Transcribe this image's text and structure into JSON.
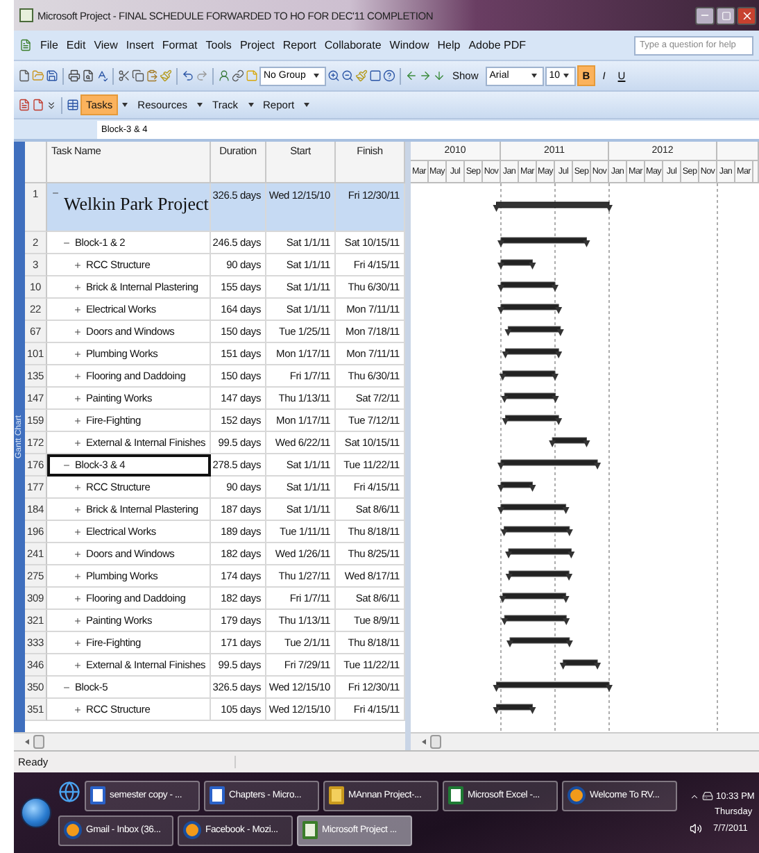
{
  "window": {
    "title": "Microsoft Project - FINAL SCHEDULE FORWARDED TO HO FOR DEC'11 COMPLETION"
  },
  "menu": [
    "File",
    "Edit",
    "View",
    "Insert",
    "Format",
    "Tools",
    "Project",
    "Report",
    "Collaborate",
    "Window",
    "Help",
    "Adobe PDF"
  ],
  "help_search": {
    "placeholder": "Type a question for help"
  },
  "toolbar": {
    "group_dropdown": "No Group",
    "show_button": "Show",
    "font_dropdown": "Arial",
    "size_dropdown": "10",
    "format_buttons": [
      {
        "label": "B",
        "selected": true
      },
      {
        "label": "I",
        "selected": false
      },
      {
        "label": "U",
        "selected": false
      }
    ]
  },
  "guide_toolbar": [
    {
      "label": "Tasks",
      "selected": true
    },
    {
      "label": "Resources",
      "selected": false
    },
    {
      "label": "Track",
      "selected": false
    },
    {
      "label": "Report",
      "selected": false
    }
  ],
  "entry_bar": {
    "value": "Block-3 & 4"
  },
  "view_bar": {
    "label": "Gantt Chart"
  },
  "table": {
    "columns": [
      "Task Name",
      "Duration",
      "Start",
      "Finish"
    ],
    "tasks": [
      {
        "id": "1",
        "name": "Welkin Park Project",
        "duration": "326.5 days",
        "start": "Wed 12/15/10",
        "finish": "Fri 12/30/11",
        "kind": "project",
        "expanded": true,
        "selected": false,
        "children": [
          {
            "id": "2",
            "name": "Block-1 & 2",
            "duration": "246.5 days",
            "start": "Sat 1/1/11",
            "finish": "Sat 10/15/11",
            "kind": "summary",
            "expanded": true,
            "selected": false,
            "children": [
              {
                "id": "3",
                "name": "RCC Structure",
                "duration": "90 days",
                "start": "Sat 1/1/11",
                "finish": "Fri 4/15/11",
                "kind": "summary",
                "expanded": false,
                "selected": false
              },
              {
                "id": "10",
                "name": "Brick & Internal Plastering",
                "duration": "155 days",
                "start": "Sat 1/1/11",
                "finish": "Thu 6/30/11",
                "kind": "summary",
                "expanded": false,
                "selected": false
              },
              {
                "id": "22",
                "name": "Electrical Works",
                "duration": "164 days",
                "start": "Sat 1/1/11",
                "finish": "Mon 7/11/11",
                "kind": "summary",
                "expanded": false,
                "selected": false
              },
              {
                "id": "67",
                "name": "Doors and Windows",
                "duration": "150 days",
                "start": "Tue 1/25/11",
                "finish": "Mon 7/18/11",
                "kind": "summary",
                "expanded": false,
                "selected": false
              },
              {
                "id": "101",
                "name": "Plumbing Works",
                "duration": "151 days",
                "start": "Mon 1/17/11",
                "finish": "Mon 7/11/11",
                "kind": "summary",
                "expanded": false,
                "selected": false
              },
              {
                "id": "135",
                "name": "Flooring and Daddoing",
                "duration": "150 days",
                "start": "Fri 1/7/11",
                "finish": "Thu 6/30/11",
                "kind": "summary",
                "expanded": false,
                "selected": false
              },
              {
                "id": "147",
                "name": "Painting Works",
                "duration": "147 days",
                "start": "Thu 1/13/11",
                "finish": "Sat 7/2/11",
                "kind": "summary",
                "expanded": false,
                "selected": false
              },
              {
                "id": "159",
                "name": "Fire-Fighting",
                "duration": "152 days",
                "start": "Mon 1/17/11",
                "finish": "Tue 7/12/11",
                "kind": "summary",
                "expanded": false,
                "selected": false
              },
              {
                "id": "172",
                "name": "External & Internal Finishes",
                "duration": "99.5 days",
                "start": "Wed 6/22/11",
                "finish": "Sat 10/15/11",
                "kind": "summary",
                "expanded": false,
                "selected": false
              }
            ]
          },
          {
            "id": "176",
            "name": "Block-3 & 4",
            "duration": "278.5 days",
            "start": "Sat 1/1/11",
            "finish": "Tue 11/22/11",
            "kind": "summary",
            "expanded": true,
            "selected": true,
            "children": [
              {
                "id": "177",
                "name": "RCC Structure",
                "duration": "90 days",
                "start": "Sat 1/1/11",
                "finish": "Fri 4/15/11",
                "kind": "summary",
                "expanded": false,
                "selected": false
              },
              {
                "id": "184",
                "name": "Brick & Internal Plastering",
                "duration": "187 days",
                "start": "Sat 1/1/11",
                "finish": "Sat 8/6/11",
                "kind": "summary",
                "expanded": false,
                "selected": false
              },
              {
                "id": "196",
                "name": "Electrical Works",
                "duration": "189 days",
                "start": "Tue 1/11/11",
                "finish": "Thu 8/18/11",
                "kind": "summary",
                "expanded": false,
                "selected": false
              },
              {
                "id": "241",
                "name": "Doors and Windows",
                "duration": "182 days",
                "start": "Wed 1/26/11",
                "finish": "Thu 8/25/11",
                "kind": "summary",
                "expanded": false,
                "selected": false
              },
              {
                "id": "275",
                "name": "Plumbing Works",
                "duration": "174 days",
                "start": "Thu 1/27/11",
                "finish": "Wed 8/17/11",
                "kind": "summary",
                "expanded": false,
                "selected": false
              },
              {
                "id": "309",
                "name": "Flooring and Daddoing",
                "duration": "182 days",
                "start": "Fri 1/7/11",
                "finish": "Sat 8/6/11",
                "kind": "summary",
                "expanded": false,
                "selected": false
              },
              {
                "id": "321",
                "name": "Painting Works",
                "duration": "179 days",
                "start": "Thu 1/13/11",
                "finish": "Tue 8/9/11",
                "kind": "summary",
                "expanded": false,
                "selected": false
              },
              {
                "id": "333",
                "name": "Fire-Fighting",
                "duration": "171 days",
                "start": "Tue 2/1/11",
                "finish": "Thu 8/18/11",
                "kind": "summary",
                "expanded": false,
                "selected": false
              },
              {
                "id": "346",
                "name": "External & Internal Finishes",
                "duration": "99.5 days",
                "start": "Fri 7/29/11",
                "finish": "Tue 11/22/11",
                "kind": "summary",
                "expanded": false,
                "selected": false
              }
            ]
          },
          {
            "id": "350",
            "name": "Block-5",
            "duration": "326.5 days",
            "start": "Wed 12/15/10",
            "finish": "Fri 12/30/11",
            "kind": "summary",
            "expanded": true,
            "selected": false,
            "children": [
              {
                "id": "351",
                "name": "RCC Structure",
                "duration": "105 days",
                "start": "Wed 12/15/10",
                "finish": "Fri 4/15/11",
                "kind": "summary",
                "expanded": false,
                "selected": false
              }
            ]
          }
        ]
      }
    ]
  },
  "timescale": {
    "years": [
      "2010",
      "2011",
      "2012"
    ],
    "months": [
      "Mar",
      "May",
      "Jul",
      "Sep",
      "Nov",
      "Jan",
      "Mar",
      "May",
      "Jul",
      "Sep",
      "Nov",
      "Jan",
      "Mar",
      "May",
      "Jul",
      "Sep",
      "Nov",
      "Jan",
      "Mar"
    ]
  },
  "status_bar": {
    "text": "Ready"
  },
  "taskbar": {
    "items": [
      {
        "label": "semester copy - ...",
        "kind": "word",
        "selected": false
      },
      {
        "label": "Chapters - Micro...",
        "kind": "word",
        "selected": false
      },
      {
        "label": "MAnnan Project-...",
        "kind": "folder",
        "selected": false
      },
      {
        "label": "Microsoft Excel -...",
        "kind": "excel",
        "selected": false
      },
      {
        "label": "Welcome To RV...",
        "kind": "firefox",
        "selected": false
      },
      {
        "label": "Gmail - Inbox (36...",
        "kind": "firefox",
        "selected": false
      },
      {
        "label": "Facebook - Mozi...",
        "kind": "firefox",
        "selected": false
      },
      {
        "label": "Microsoft Project ...",
        "kind": "project",
        "selected": true
      }
    ],
    "clock": {
      "time": "10:33 PM",
      "day": "Thursday",
      "date": "7/7/2011"
    }
  }
}
